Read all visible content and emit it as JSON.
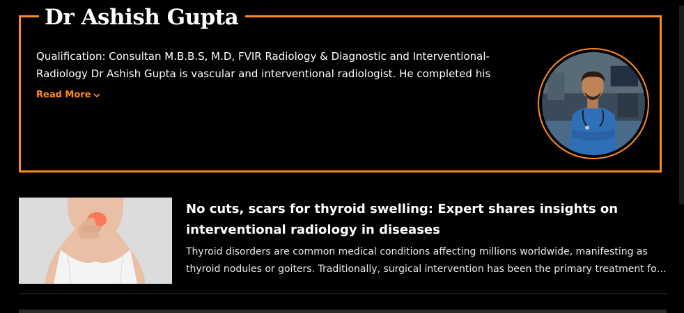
{
  "author": {
    "name": "Dr Ashish Gupta",
    "bio": "Qualification: Consultan M.B.B.S, M.D, FVIR Radiology & Diagnostic and Interventional-Radiology Dr Ashish Gupta is vascular and interventional radiologist. He completed his",
    "read_more_label": "Read More",
    "avatar_icon": "doctor-portrait",
    "accent_color": "#ff8b1f"
  },
  "article": {
    "title": "No cuts, scars for thyroid swelling: Expert shares insights on interventional radiology in diseases",
    "excerpt": "Thyroid disorders are common medical conditions affecting millions worldwide, manifesting as thyroid nodules or goiters. Traditionally, surgical intervention has been the primary treatment for this condition.",
    "thumbnail_icon": "thyroid-neck-photo"
  }
}
